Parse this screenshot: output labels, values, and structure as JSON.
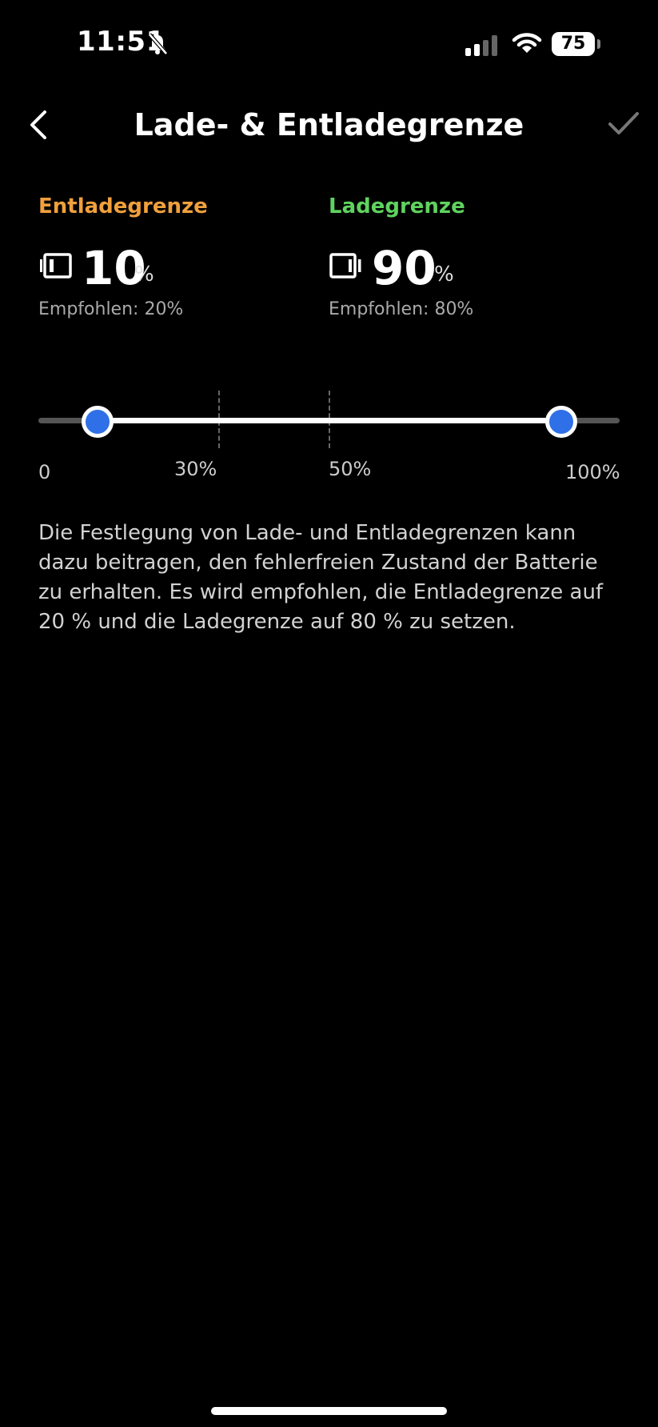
{
  "status_bar": {
    "time": "11:51",
    "battery_level": "75",
    "icons": [
      "bell-slash-icon",
      "signal-icon",
      "wifi-icon",
      "battery-icon"
    ]
  },
  "header": {
    "title": "Lade- & Entladegrenze",
    "back_icon": "chevron-left-icon",
    "confirm_icon": "checkmark-icon"
  },
  "discharge": {
    "label": "Entladegrenze",
    "value": "10",
    "unit": "%",
    "recommendation": "Empfohlen: 20%",
    "color": "#f0a03c"
  },
  "charge": {
    "label": "Ladegrenze",
    "value": "90",
    "unit": "%",
    "recommendation": "Empfohlen: 80%",
    "color": "#5fd35f"
  },
  "slider": {
    "low_percent": 10,
    "high_percent": 90,
    "thumb_color": "#2f6fe8",
    "scale_labels": {
      "min": "0",
      "mark_30": "30%",
      "mark_50": "50%",
      "max": "100%"
    }
  },
  "description": "Die Festlegung von Lade- und Entladegrenzen kann dazu beitragen, den fehlerfreien Zustand der Batterie zu erhalten. Es wird empfohlen, die Entladegrenze auf 20 % und die Ladegrenze auf 80 % zu setzen."
}
